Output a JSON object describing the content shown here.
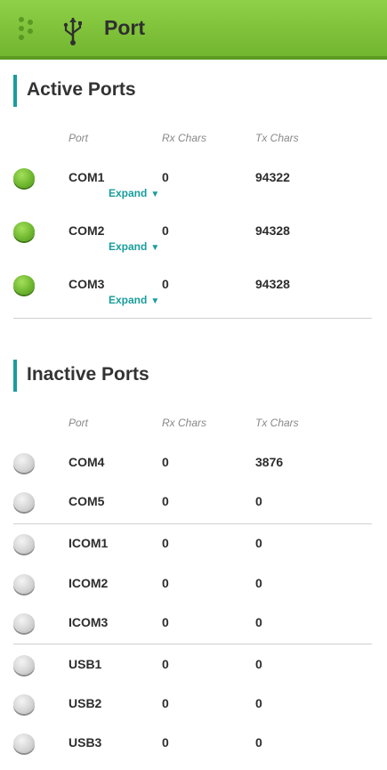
{
  "header": {
    "title": "Port",
    "icons": [
      "menu-dots-icon",
      "usb-icon"
    ]
  },
  "columns": {
    "port": "Port",
    "rx": "Rx Chars",
    "tx": "Tx Chars"
  },
  "active": {
    "title": "Active Ports",
    "expand_label": "Expand",
    "rows": [
      {
        "port": "COM1",
        "rx": "0",
        "tx": "94322"
      },
      {
        "port": "COM2",
        "rx": "0",
        "tx": "94328"
      },
      {
        "port": "COM3",
        "rx": "0",
        "tx": "94328"
      }
    ]
  },
  "inactive": {
    "title": "Inactive Ports",
    "rows": [
      {
        "port": "COM4",
        "rx": "0",
        "tx": "3876"
      },
      {
        "port": "COM5",
        "rx": "0",
        "tx": "0"
      },
      {
        "port": "ICOM1",
        "rx": "0",
        "tx": "0"
      },
      {
        "port": "ICOM2",
        "rx": "0",
        "tx": "0"
      },
      {
        "port": "ICOM3",
        "rx": "0",
        "tx": "0"
      },
      {
        "port": "USB1",
        "rx": "0",
        "tx": "0"
      },
      {
        "port": "USB2",
        "rx": "0",
        "tx": "0"
      },
      {
        "port": "USB3",
        "rx": "0",
        "tx": "0"
      }
    ]
  },
  "colors": {
    "accent": "#1a9c9c",
    "header": "#7cc13a",
    "led_active": "#6cb52c",
    "led_inactive": "#c8c8c8"
  }
}
